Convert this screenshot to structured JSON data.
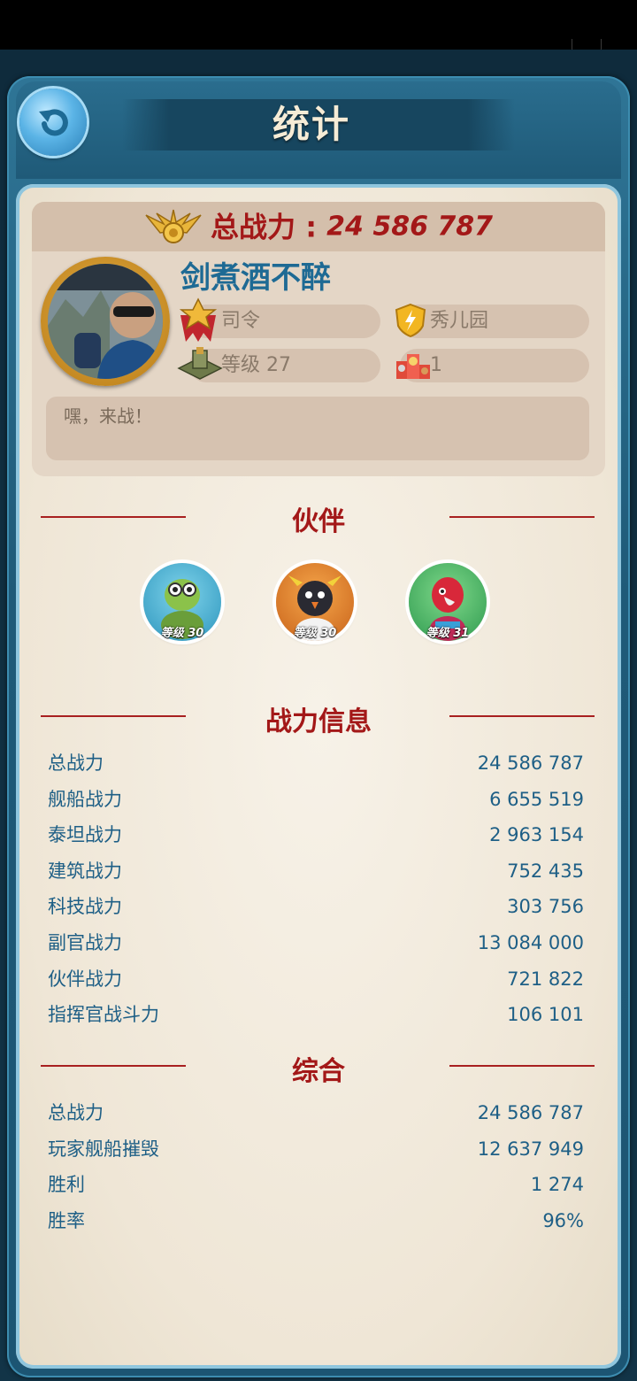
{
  "header": {
    "title": "统计"
  },
  "profile": {
    "power_label": "总战力 : ",
    "power_value": "24 586 787",
    "name": "剑煮酒不醉",
    "rank": "司令",
    "alliance": "秀儿园",
    "level": "等级 27",
    "medals": "1",
    "motto": "嘿，来战！"
  },
  "partners": {
    "title": "伙伴",
    "items": [
      {
        "name": "turtle",
        "level": "等级 30",
        "color": "#3ba6c8"
      },
      {
        "name": "penguin",
        "level": "等级 30",
        "color": "#e07a1e"
      },
      {
        "name": "parrot",
        "level": "等级 31",
        "color": "#3fae5f"
      }
    ]
  },
  "power_info": {
    "title": "战力信息",
    "rows": [
      {
        "label": "总战力",
        "value": "24 586 787"
      },
      {
        "label": "舰船战力",
        "value": "6 655 519"
      },
      {
        "label": "泰坦战力",
        "value": "2 963 154"
      },
      {
        "label": "建筑战力",
        "value": "752 435"
      },
      {
        "label": "科技战力",
        "value": "303 756"
      },
      {
        "label": "副官战力",
        "value": "13 084 000"
      },
      {
        "label": "伙伴战力",
        "value": "721 822"
      },
      {
        "label": "指挥官战斗力",
        "value": "106 101"
      }
    ]
  },
  "summary": {
    "title": "综合",
    "rows": [
      {
        "label": "总战力",
        "value": "24 586 787"
      },
      {
        "label": "玩家舰船摧毁",
        "value": "12 637 949"
      },
      {
        "label": "胜利",
        "value": "1 274"
      },
      {
        "label": "胜率",
        "value": "96%"
      }
    ]
  },
  "colors": {
    "accent_red": "#a31818",
    "stat_blue": "#1e5f86",
    "name_blue": "#1e6a94"
  }
}
